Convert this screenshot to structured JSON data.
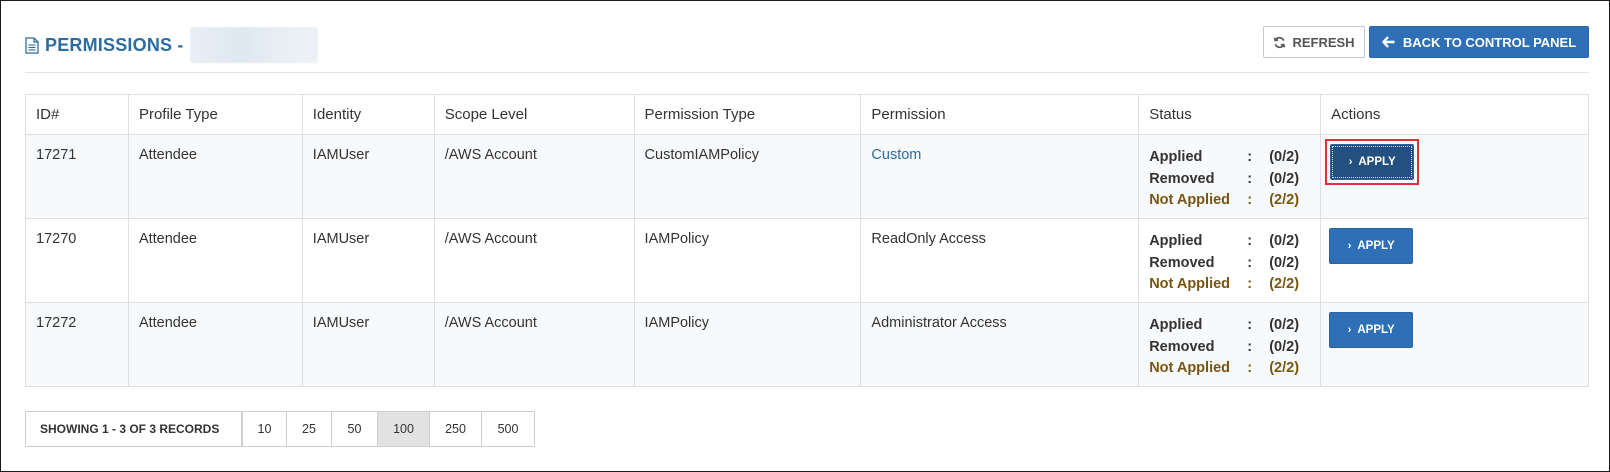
{
  "header": {
    "title": "PERMISSIONS -",
    "refresh_label": "REFRESH",
    "back_label": "BACK TO CONTROL PANEL"
  },
  "table": {
    "columns": [
      "ID#",
      "Profile Type",
      "Identity",
      "Scope Level",
      "Permission Type",
      "Permission",
      "Status",
      "Actions"
    ],
    "rows": [
      {
        "id": "17271",
        "profile_type": "Attendee",
        "identity": "IAMUser",
        "scope": "/AWS Account",
        "permission_type": "CustomIAMPolicy",
        "permission": "Custom",
        "applied": "(0/2)",
        "removed": "(0/2)",
        "not_applied": "(2/2)",
        "action": "APPLY"
      },
      {
        "id": "17270",
        "profile_type": "Attendee",
        "identity": "IAMUser",
        "scope": "/AWS Account",
        "permission_type": "IAMPolicy",
        "permission": "ReadOnly Access",
        "applied": "(0/2)",
        "removed": "(0/2)",
        "not_applied": "(2/2)",
        "action": "APPLY"
      },
      {
        "id": "17272",
        "profile_type": "Attendee",
        "identity": "IAMUser",
        "scope": "/AWS Account",
        "permission_type": "IAMPolicy",
        "permission": "Administrator Access",
        "applied": "(0/2)",
        "removed": "(0/2)",
        "not_applied": "(2/2)",
        "action": "APPLY"
      }
    ],
    "status_labels": {
      "applied": "Applied",
      "removed": "Removed",
      "not_applied": "Not Applied",
      "colon": ":"
    }
  },
  "pagination": {
    "showing": "SHOWING 1 - 3 OF 3 RECORDS",
    "sizes": [
      "10",
      "25",
      "50",
      "100",
      "250",
      "500"
    ],
    "active": "100"
  },
  "colors": {
    "brand": "#2f6fb5",
    "title": "#2d6ca2",
    "not_applied": "#7a5510",
    "highlight": "#e0303a"
  }
}
